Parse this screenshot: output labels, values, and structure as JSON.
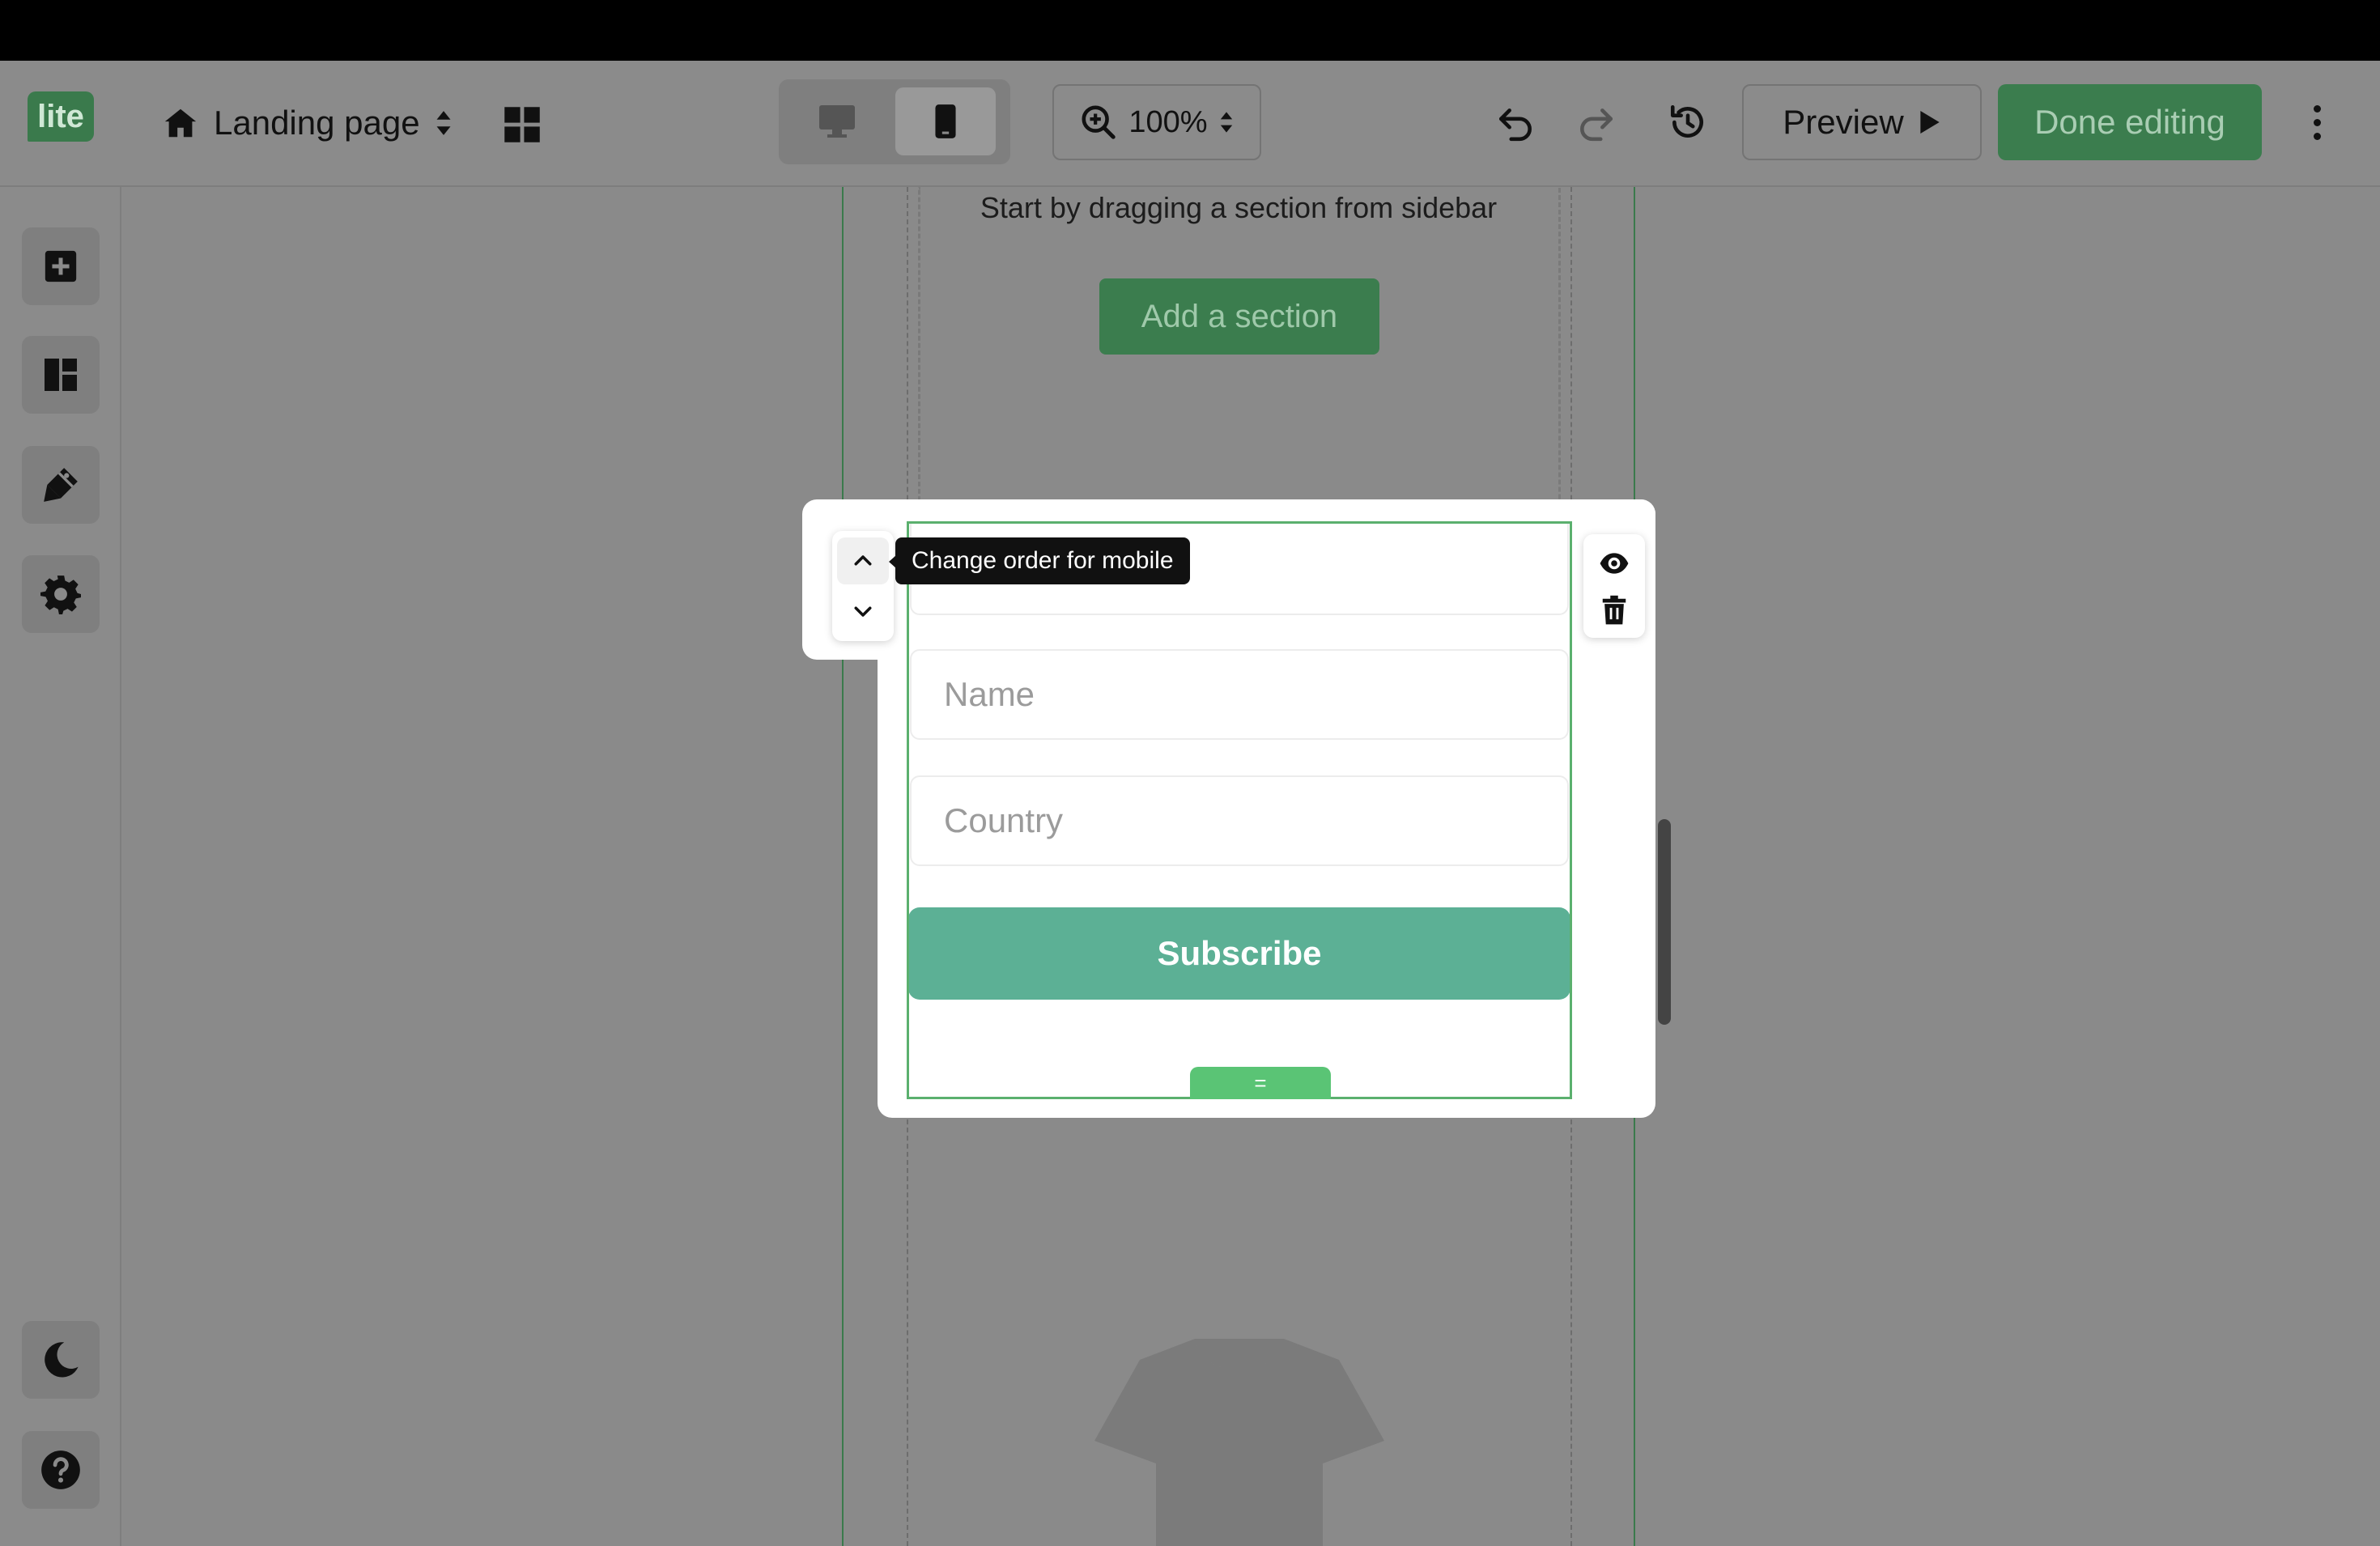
{
  "header": {
    "logo_text": "lite",
    "page_name": "Landing page",
    "zoom_level": "100%",
    "preview_label": "Preview",
    "done_label": "Done editing"
  },
  "canvas": {
    "empty_hint": "Start by dragging a section from sidebar",
    "add_section_label": "Add a section"
  },
  "form": {
    "name_placeholder": "Name",
    "country_placeholder": "Country",
    "subscribe_label": "Subscribe",
    "drag_handle_glyph": "="
  },
  "tooltip": {
    "text": "Change order for mobile"
  },
  "icons": {
    "sidebar": [
      "add-block-icon",
      "layout-icon",
      "design-brush-icon",
      "settings-gear-icon",
      "dark-mode-moon-icon",
      "help-icon"
    ],
    "header": [
      "home-icon",
      "sort-arrows-icon",
      "grid-icon",
      "desktop-icon",
      "mobile-icon",
      "zoom-in-icon",
      "undo-icon",
      "redo-icon",
      "history-icon",
      "play-icon",
      "more-vertical-icon"
    ],
    "block_tools": [
      "chevron-up-icon",
      "chevron-down-icon",
      "eye-icon",
      "trash-icon"
    ]
  },
  "colors": {
    "brand_green": "#3b7d4e",
    "subscribe_teal": "#5cb095",
    "selection_green": "#5ac475"
  }
}
